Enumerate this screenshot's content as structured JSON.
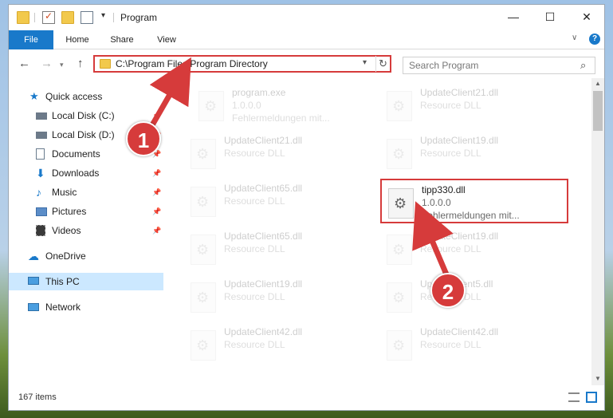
{
  "window": {
    "title": "Program"
  },
  "ribbon": {
    "tabs": [
      "File",
      "Home",
      "Share",
      "View"
    ]
  },
  "address": {
    "path": "C:\\Program Files\\Program Directory"
  },
  "search": {
    "placeholder": "Search Program"
  },
  "sidebar": {
    "items": [
      {
        "label": "Quick access",
        "icon": "star-icon",
        "pinned": false
      },
      {
        "label": "Local Disk (C:)",
        "icon": "drive-icon",
        "pinned": true
      },
      {
        "label": "Local Disk (D:)",
        "icon": "drive-icon",
        "pinned": true
      },
      {
        "label": "Documents",
        "icon": "document-icon",
        "pinned": true
      },
      {
        "label": "Downloads",
        "icon": "download-icon",
        "pinned": true
      },
      {
        "label": "Music",
        "icon": "music-icon",
        "pinned": true
      },
      {
        "label": "Pictures",
        "icon": "pictures-icon",
        "pinned": true
      },
      {
        "label": "Videos",
        "icon": "video-icon",
        "pinned": true
      },
      {
        "label": "OneDrive",
        "icon": "cloud-icon",
        "pinned": false
      },
      {
        "label": "This PC",
        "icon": "computer-icon",
        "pinned": false,
        "selected": true
      },
      {
        "label": "Network",
        "icon": "network-icon",
        "pinned": false
      }
    ]
  },
  "files": [
    {
      "name": "program.exe",
      "line2": "1.0.0.0",
      "line3": "Fehlermeldungen mit...",
      "highlighted": false
    },
    {
      "name": "UpdateClient21.dll",
      "line2": "Resource DLL",
      "line3": "",
      "highlighted": false
    },
    {
      "name": "UpdateClient21.dll",
      "line2": "Resource DLL",
      "line3": "",
      "highlighted": false
    },
    {
      "name": "UpdateClient19.dll",
      "line2": "Resource DLL",
      "line3": "",
      "highlighted": false
    },
    {
      "name": "UpdateClient65.dll",
      "line2": "Resource DLL",
      "line3": "",
      "highlighted": false
    },
    {
      "name": "tipp330.dll",
      "line2": "1.0.0.0",
      "line3": "Fehlermeldungen mit...",
      "highlighted": true
    },
    {
      "name": "UpdateClient65.dll",
      "line2": "Resource DLL",
      "line3": "",
      "highlighted": false
    },
    {
      "name": "UpdateClient19.dll",
      "line2": "Resource DLL",
      "line3": "",
      "highlighted": false
    },
    {
      "name": "UpdateClient19.dll",
      "line2": "Resource DLL",
      "line3": "",
      "highlighted": false
    },
    {
      "name": "UpdateClient5.dll",
      "line2": "Resource DLL",
      "line3": "",
      "highlighted": false
    },
    {
      "name": "UpdateClient42.dll",
      "line2": "Resource DLL",
      "line3": "",
      "highlighted": false
    },
    {
      "name": "UpdateClient42.dll",
      "line2": "Resource DLL",
      "line3": "",
      "highlighted": false
    }
  ],
  "status": {
    "count": "167 items"
  },
  "annotations": {
    "badge1": "1",
    "badge2": "2",
    "color": "#d63b3b"
  },
  "colors": {
    "accent": "#1979ca",
    "highlight": "#d63b3b",
    "selection": "#cce8ff"
  }
}
